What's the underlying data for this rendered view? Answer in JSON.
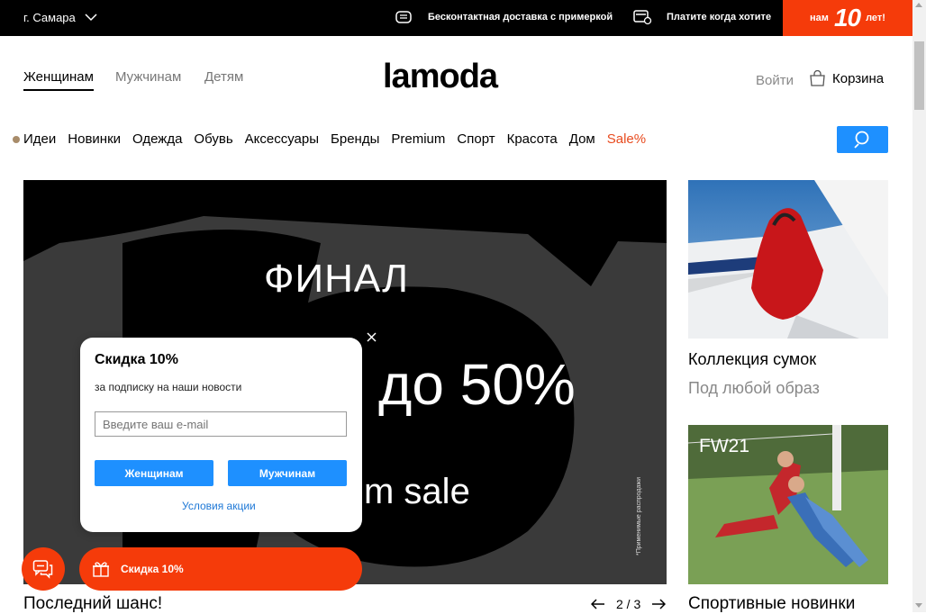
{
  "topbar": {
    "city": "г. Самара",
    "delivery": "Бесконтактная доставка с примеркой",
    "pay_later": "Платите когда хотите",
    "anniversary_pre": "нам",
    "anniversary_num": "10",
    "anniversary_post": "лет!",
    "accent_color": "#f53b0a"
  },
  "header": {
    "tabs": [
      "Женщинам",
      "Мужчинам",
      "Детям"
    ],
    "active_tab": "Женщинам",
    "logo": "lamoda",
    "login": "Войти",
    "cart": "Корзина"
  },
  "nav": {
    "items": [
      "Идеи",
      "Новинки",
      "Одежда",
      "Обувь",
      "Аксессуары",
      "Бренды",
      "Premium",
      "Спорт",
      "Красота",
      "Дом"
    ],
    "sale": "Sale%",
    "sale_color": "#e84b1f",
    "search_color": "#1e90ff"
  },
  "hero": {
    "line1": "ФИНАЛ",
    "line2": "до 50%",
    "line3": "m sale",
    "note": "*Применимые распродажи",
    "title": "Последний шанс!",
    "pager": "2 / 3"
  },
  "popup": {
    "title": "Скидка 10%",
    "subtitle": "за подписку на наши новости",
    "email_placeholder": "Введите ваш e-mail",
    "women_button": "Женщинам",
    "men_button": "Мужчинам",
    "terms": "Условия акции"
  },
  "floating": {
    "discount_label": "Скидка 10%"
  },
  "side": {
    "card1_title": "Коллекция сумок",
    "card1_subtitle": "Под любой образ",
    "card2_badge": "FW21",
    "card2_title": "Спортивные новинки"
  }
}
